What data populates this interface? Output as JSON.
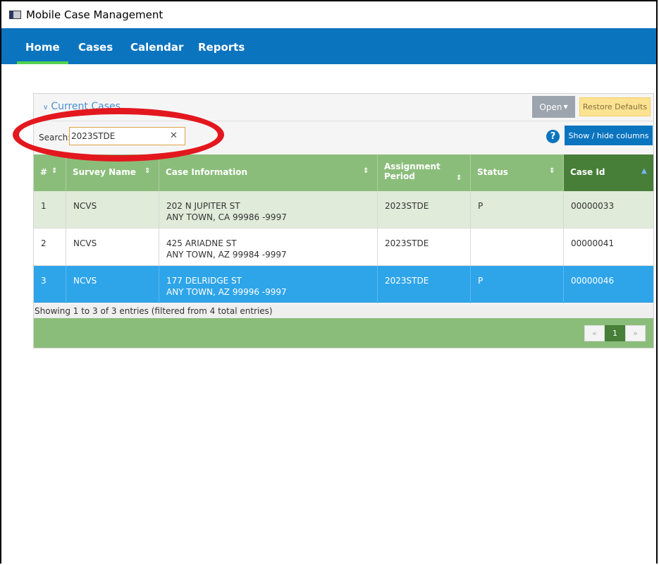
{
  "window": {
    "title": "Mobile Case Management"
  },
  "nav": {
    "items": [
      "Home",
      "Cases",
      "Calendar",
      "Reports"
    ],
    "active": "Home"
  },
  "panel": {
    "title": "Current Cases",
    "open_label": "Open",
    "restore_label": "Restore Defaults",
    "search_label": "Search:",
    "search_value": "2023STDE",
    "show_hide_label": "Show / hide columns"
  },
  "table": {
    "columns": [
      "#",
      "Survey Name",
      "Case Information",
      "Assignment Period",
      "Status",
      "Case Id"
    ],
    "sorted_column": "Case Id",
    "rows": [
      {
        "num": "1",
        "survey": "NCVS",
        "addr1": "202 N JUPITER ST",
        "addr2": "ANY TOWN, CA 99986 -9997",
        "period": "2023STDE",
        "status": "P",
        "case_id": "00000033"
      },
      {
        "num": "2",
        "survey": "NCVS",
        "addr1": "425 ARIADNE ST",
        "addr2": "ANY TOWN, AZ 99984 -9997",
        "period": "2023STDE",
        "status": "",
        "case_id": "00000041"
      },
      {
        "num": "3",
        "survey": "NCVS",
        "addr1": "177 DELRIDGE ST",
        "addr2": "ANY TOWN, AZ 99996 -9997",
        "period": "2023STDE",
        "status": "P",
        "case_id": "00000046",
        "selected": true
      }
    ],
    "info": "Showing 1 to 3 of 3 entries (filtered from 4 total entries)"
  },
  "pagination": {
    "prev": "«",
    "current": "1",
    "next": "»"
  },
  "colors": {
    "nav_bg": "#0b74bf",
    "header_green": "#8bbd7a",
    "selected_row": "#2fa5e9",
    "highlight": "#e3171e"
  }
}
